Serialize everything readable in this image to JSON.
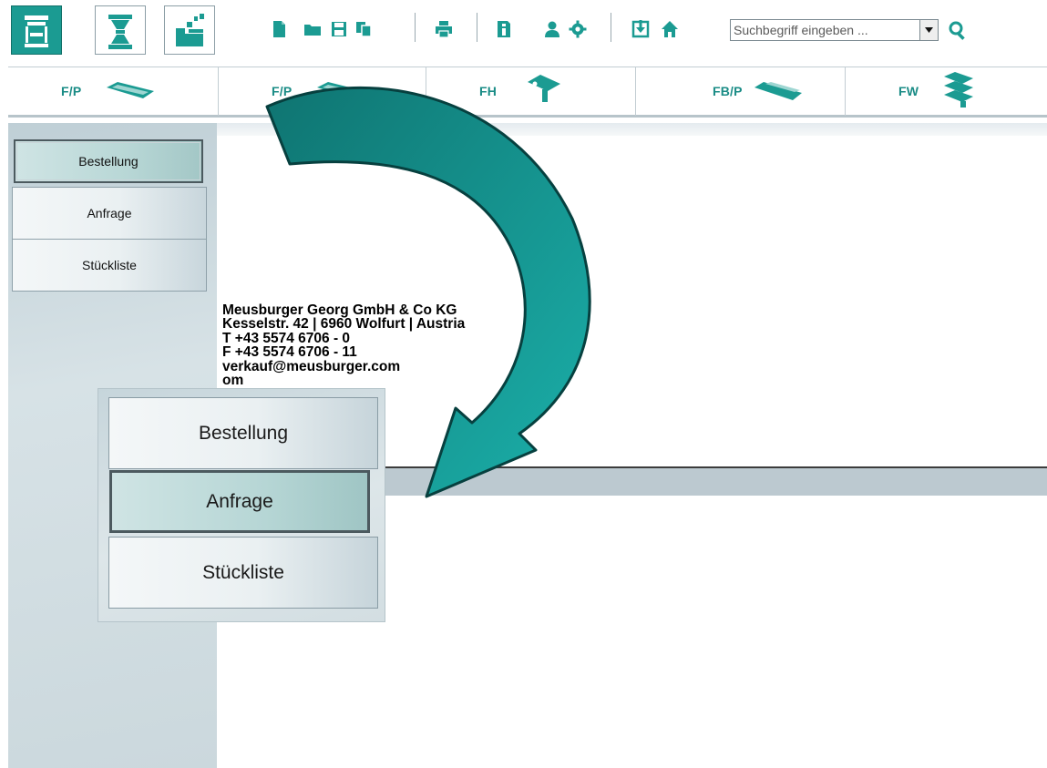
{
  "toolbar": {
    "view_buttons": [
      {
        "icon": "mold-base-icon",
        "active": true
      },
      {
        "icon": "standard-parts-icon",
        "active": false
      },
      {
        "icon": "workshop-icon",
        "active": false
      }
    ],
    "icons": [
      "new-document-icon",
      "open-folder-icon",
      "save-icon",
      "copy-icon",
      "print-icon",
      "info-icon",
      "user-icon",
      "settings-icon",
      "download-icon",
      "home-icon"
    ],
    "search": {
      "placeholder": "Suchbegriff eingeben ...",
      "value": ""
    }
  },
  "categories": [
    {
      "label": "F/P",
      "icon": "plate-icon"
    },
    {
      "label": "F/P",
      "icon": "plate-stack-icon"
    },
    {
      "label": "FH",
      "icon": "clamp-icon"
    },
    {
      "label": "FB/P",
      "icon": "bar-plate-icon"
    },
    {
      "label": "FW",
      "icon": "stack-plates-icon"
    }
  ],
  "sidebar": {
    "items": [
      {
        "label": "Bestellung",
        "selected": true
      },
      {
        "label": "Anfrage",
        "selected": false
      },
      {
        "label": "Stückliste",
        "selected": false
      }
    ]
  },
  "company": {
    "name": "Meusburger Georg GmbH & Co KG",
    "address": "Kesselstr. 42 | 6960 Wolfurt | Austria",
    "phone": "T +43 5574 6706 - 0",
    "fax": "F +43 5574 6706 - 11",
    "email": "verkauf@meusburger.com",
    "web": "om"
  },
  "zoom": {
    "items": [
      {
        "label": "Bestellung",
        "selected": false
      },
      {
        "label": "Anfrage",
        "selected": true
      },
      {
        "label": "Stückliste",
        "selected": false
      }
    ]
  },
  "colors": {
    "accent": "#1b9b92",
    "arrow": "#1a9e98",
    "arrow_dark": "#0d5f5d"
  }
}
